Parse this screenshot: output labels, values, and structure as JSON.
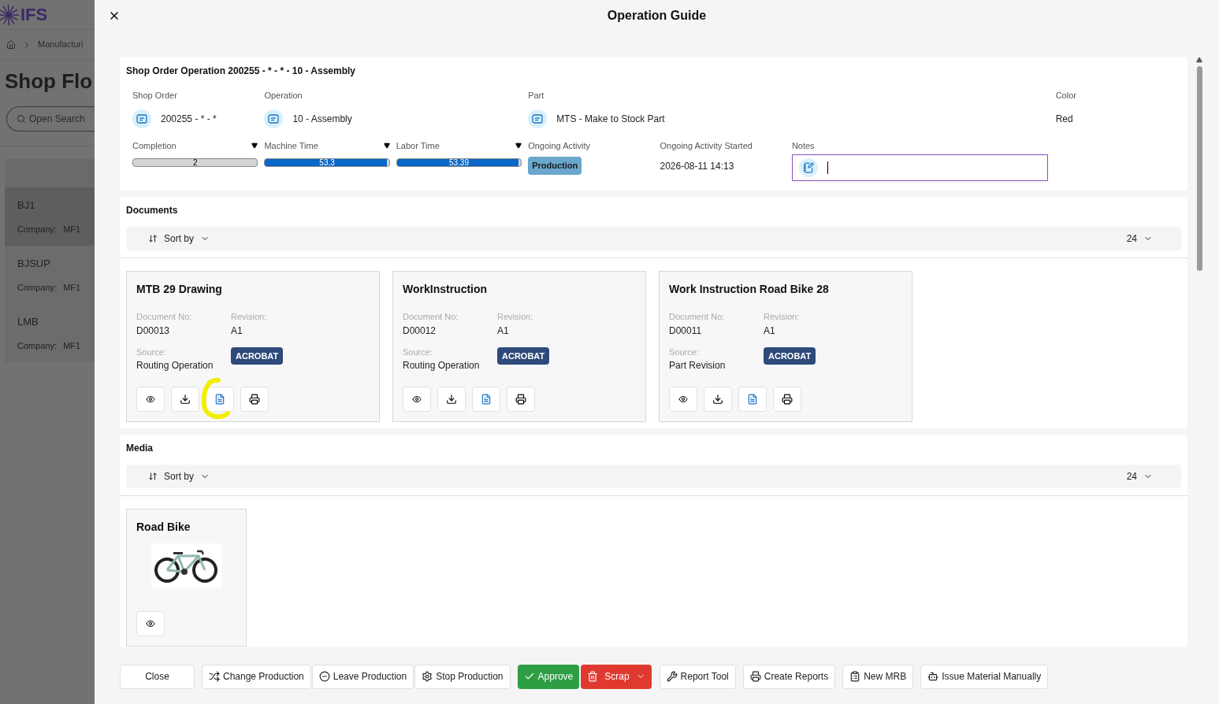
{
  "background": {
    "logo": "IFS",
    "breadcrumb": "Manufacturi",
    "page_title": "Shop Flo",
    "search_placeholder": "Open Search",
    "items": [
      {
        "name": "BJ1",
        "company_label": "Company:",
        "company": "MF1",
        "selected": true
      },
      {
        "name": "BJSUP",
        "company_label": "Company:",
        "company": "MF1",
        "selected": false
      },
      {
        "name": "LMB",
        "company_label": "Company:",
        "company": "MF1",
        "selected": false
      }
    ]
  },
  "dialog": {
    "title": "Operation Guide"
  },
  "operation": {
    "title": "Shop Order Operation 200255 - * - * - 10 - Assembly",
    "fields": [
      {
        "label": "Shop Order",
        "value": "200255 - * - *",
        "kind": "link"
      },
      {
        "label": "Operation",
        "value": "10 - Assembly",
        "kind": "link"
      },
      {
        "label": "Part",
        "value": "MTS - Make to Stock Part",
        "kind": "link"
      },
      {
        "label": "Color",
        "value": "Red",
        "kind": "text"
      }
    ],
    "meters": [
      {
        "label": "Completion",
        "reading": "2",
        "level": 0
      },
      {
        "label": "Machine Time",
        "reading": "53.3",
        "level": 0.98
      },
      {
        "label": "Labor Time",
        "reading": "53.39",
        "level": 0.98
      }
    ],
    "activity": {
      "label": "Ongoing Activity",
      "badge": "Production"
    },
    "started": {
      "label": "Ongoing Activity Started",
      "value": "2026-08-11 14:13"
    },
    "notes": {
      "label": "Notes",
      "focused": true
    }
  },
  "documents": {
    "title": "Documents",
    "sort_label": "Sort by",
    "count": "24",
    "cards": [
      {
        "title": "MTB 29 Drawing",
        "doc_no_label": "Document No:",
        "doc_no": "D00013",
        "revision_label": "Revision:",
        "revision": "A1",
        "source_label": "Source:",
        "source": "Routing Operation",
        "format": "ACROBAT",
        "highlighted": true
      },
      {
        "title": "WorkInstruction",
        "doc_no_label": "Document No:",
        "doc_no": "D00012",
        "revision_label": "Revision:",
        "revision": "A1",
        "source_label": "Source:",
        "source": "Routing Operation",
        "format": "ACROBAT",
        "highlighted": false
      },
      {
        "title": "Work Instruction Road Bike 28",
        "doc_no_label": "Document No:",
        "doc_no": "D00011",
        "revision_label": "Revision:",
        "revision": "A1",
        "source_label": "Source:",
        "source": "Part Revision",
        "format": "ACROBAT",
        "highlighted": false
      }
    ]
  },
  "media": {
    "title": "Media",
    "sort_label": "Sort by",
    "count": "24",
    "items": [
      {
        "title": "Road Bike",
        "kind": "picture"
      }
    ]
  },
  "footer": [
    {
      "label": "Close",
      "kind": "plain"
    },
    {
      "label": "Change Production",
      "kind": "plain"
    },
    {
      "label": "Leave Production",
      "kind": "plain"
    },
    {
      "label": "Stop Production",
      "kind": "plain"
    },
    {
      "label": "Approve",
      "kind": "success"
    },
    {
      "label": "Scrap",
      "kind": "danger"
    },
    {
      "label": "Report Tool",
      "kind": "plain"
    },
    {
      "label": "Create Reports",
      "kind": "plain"
    },
    {
      "label": "New MRB",
      "kind": "plain"
    },
    {
      "label": "Issue Material Manually",
      "kind": "plain"
    }
  ]
}
